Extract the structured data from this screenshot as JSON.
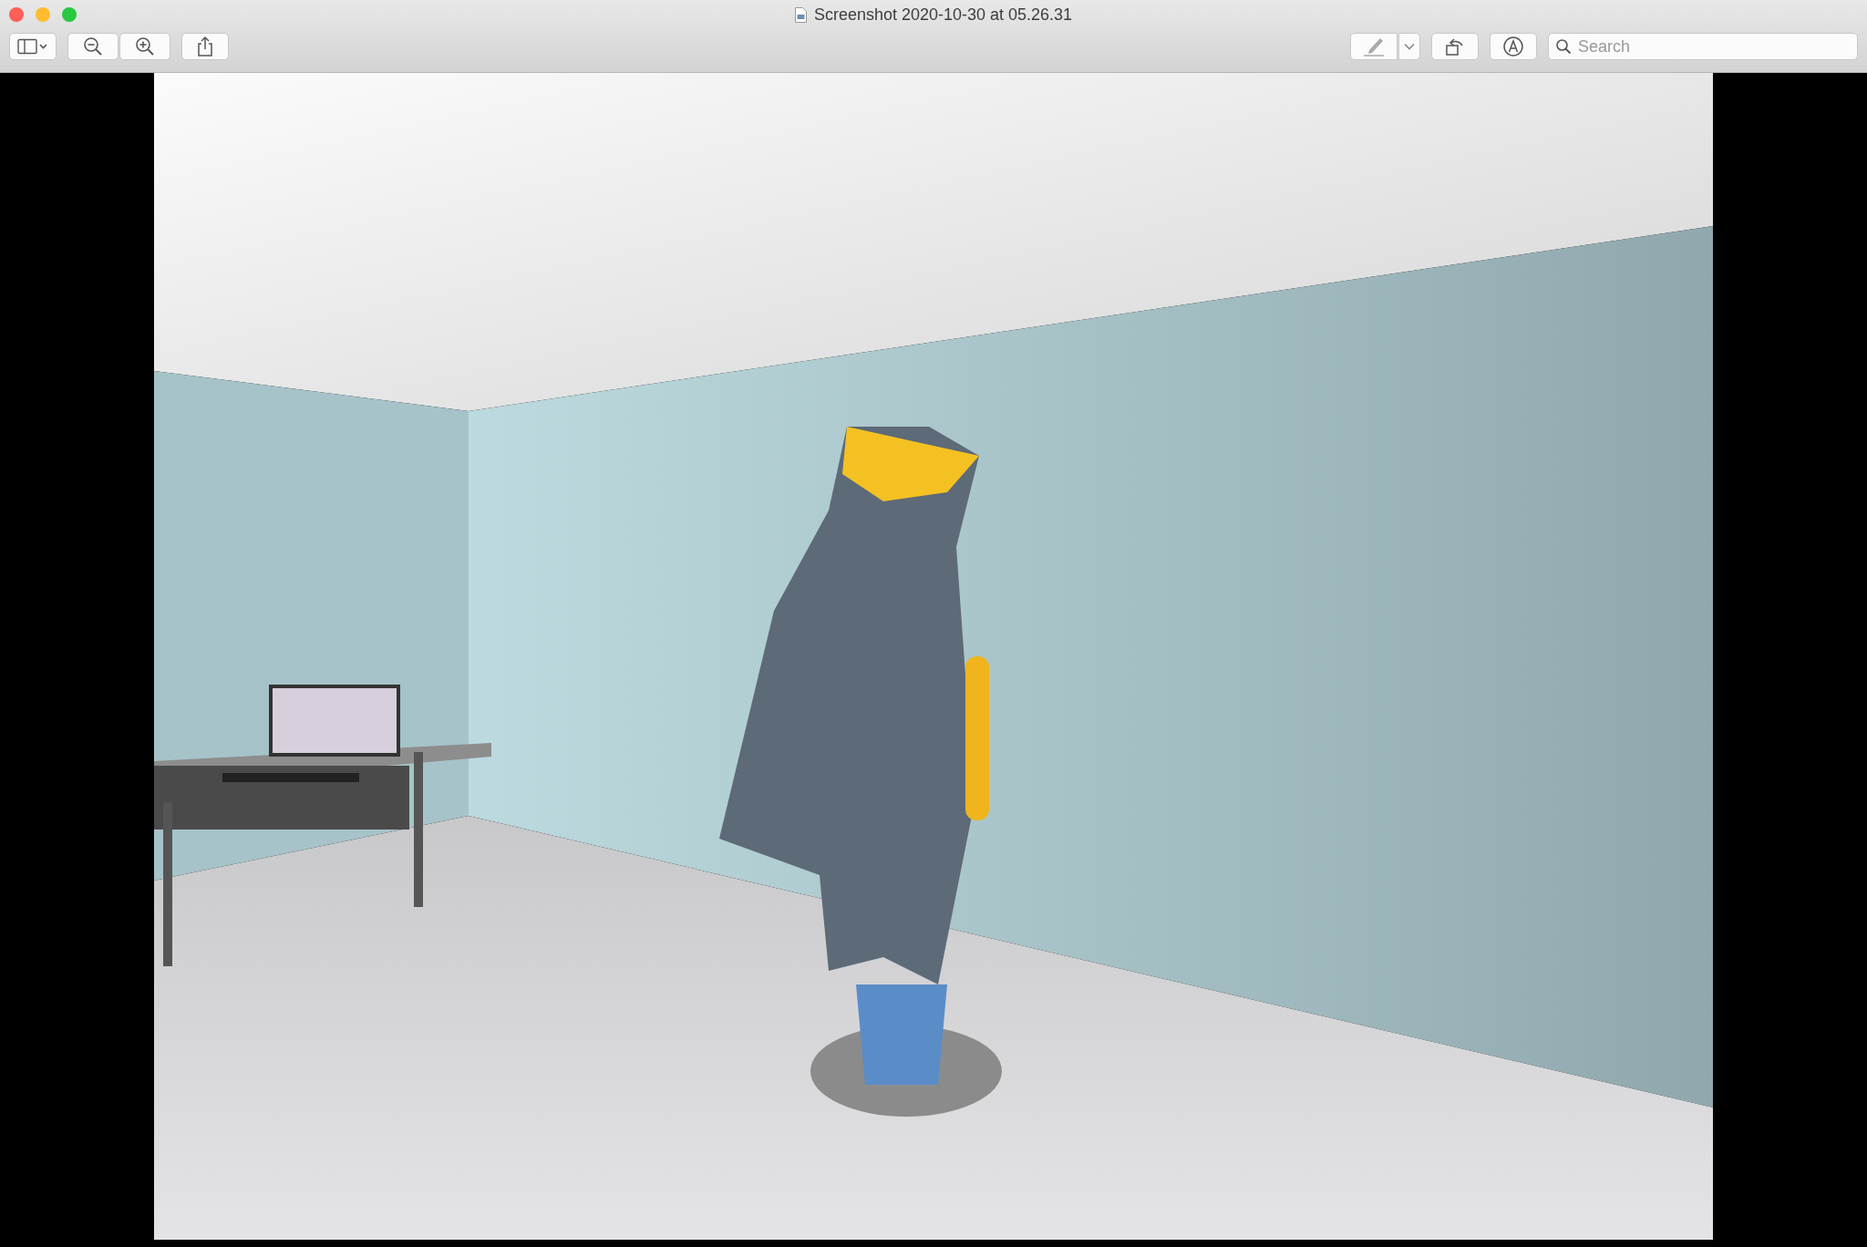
{
  "window": {
    "title": "Screenshot 2020-10-30 at 05.26.31"
  },
  "search": {
    "placeholder": "Search"
  }
}
